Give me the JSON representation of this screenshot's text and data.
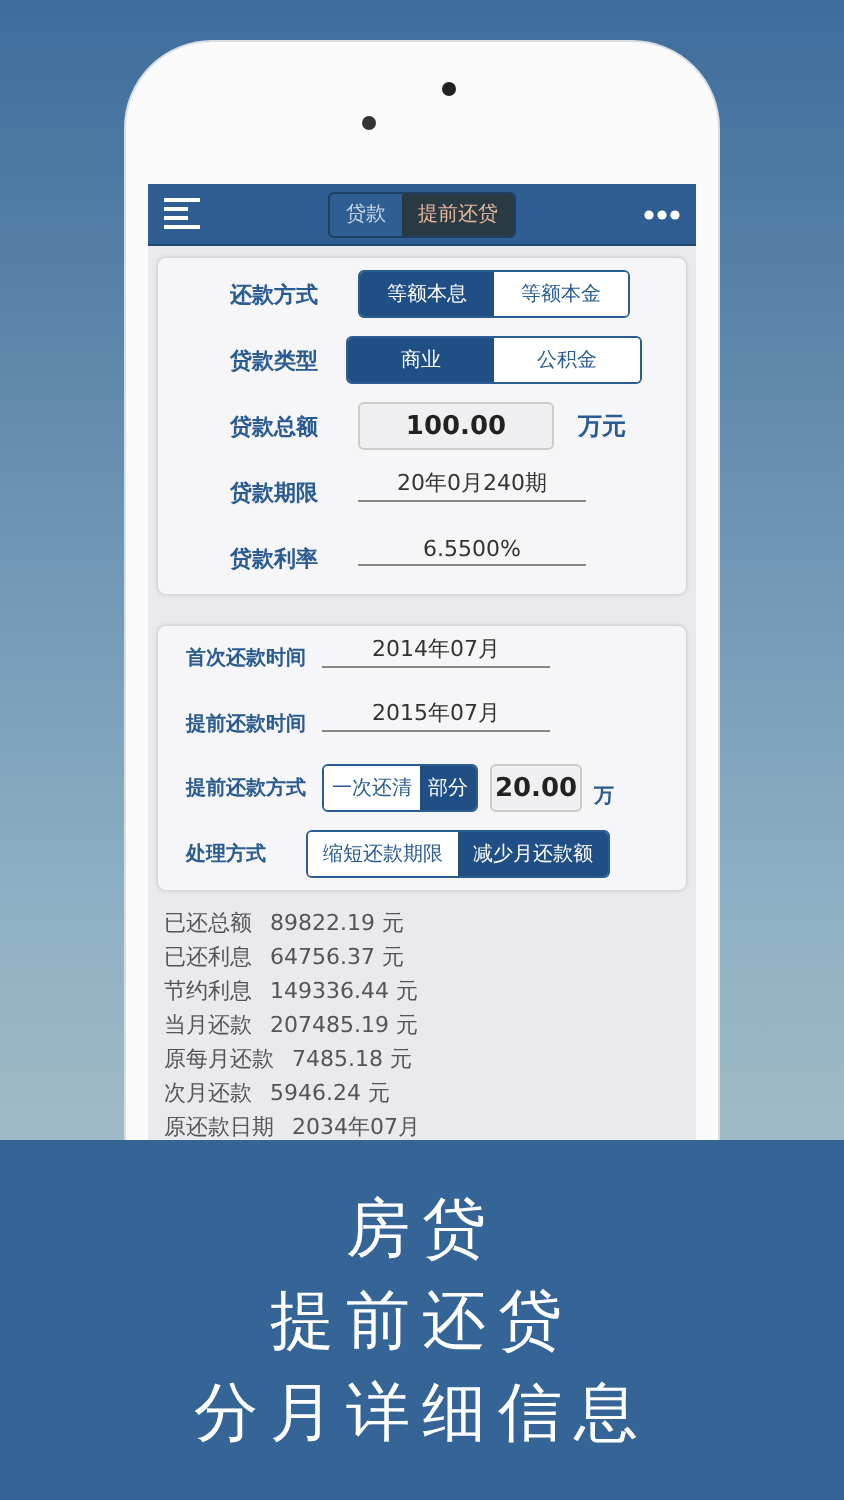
{
  "nav": {
    "tabs": [
      {
        "label": "贷款",
        "selected": false
      },
      {
        "label": "提前还贷",
        "selected": true
      }
    ]
  },
  "loan_form": {
    "rows": [
      {
        "kind": "segmented",
        "label": "还款方式",
        "options": [
          {
            "label": "等额本息",
            "selected": true
          },
          {
            "label": "等额本金",
            "selected": false
          }
        ]
      },
      {
        "kind": "segmented",
        "label": "贷款类型",
        "options": [
          {
            "label": "商业",
            "selected": true
          },
          {
            "label": "公积金",
            "selected": false
          }
        ]
      },
      {
        "kind": "input",
        "label": "贷款总额",
        "value": "100.00",
        "unit": "万元"
      },
      {
        "kind": "picker",
        "label": "贷款期限",
        "value": "20年0月240期"
      },
      {
        "kind": "picker",
        "label": "贷款利率",
        "value": "6.5500%"
      }
    ]
  },
  "prepay_form": {
    "rows": [
      {
        "kind": "picker",
        "label": "首次还款时间",
        "value": "2014年07月"
      },
      {
        "kind": "picker",
        "label": "提前还款时间",
        "value": "2015年07月"
      },
      {
        "kind": "segmented_input",
        "label": "提前还款方式",
        "options": [
          {
            "label": "一次还清",
            "selected": false
          },
          {
            "label": "部分",
            "selected": true
          }
        ],
        "value": "20.00",
        "unit": "万"
      },
      {
        "kind": "segmented",
        "label": "处理方式",
        "options": [
          {
            "label": "缩短还款期限",
            "selected": false
          },
          {
            "label": "减少月还款额",
            "selected": true
          }
        ]
      }
    ]
  },
  "results": [
    {
      "label": "已还总额",
      "value": "89822.19 元"
    },
    {
      "label": "已还利息",
      "value": "64756.37 元"
    },
    {
      "label": "节约利息",
      "value": "149336.44 元"
    },
    {
      "label": "当月还款",
      "value": "207485.19 元"
    },
    {
      "label": "原每月还款",
      "value": "7485.18 元"
    },
    {
      "label": "次月还款",
      "value": "5946.24 元"
    },
    {
      "label": "原还款日期",
      "value": "2034年07月"
    }
  ],
  "banner": {
    "lines": [
      "房贷",
      "提前还贷",
      "分月详细信息"
    ]
  }
}
